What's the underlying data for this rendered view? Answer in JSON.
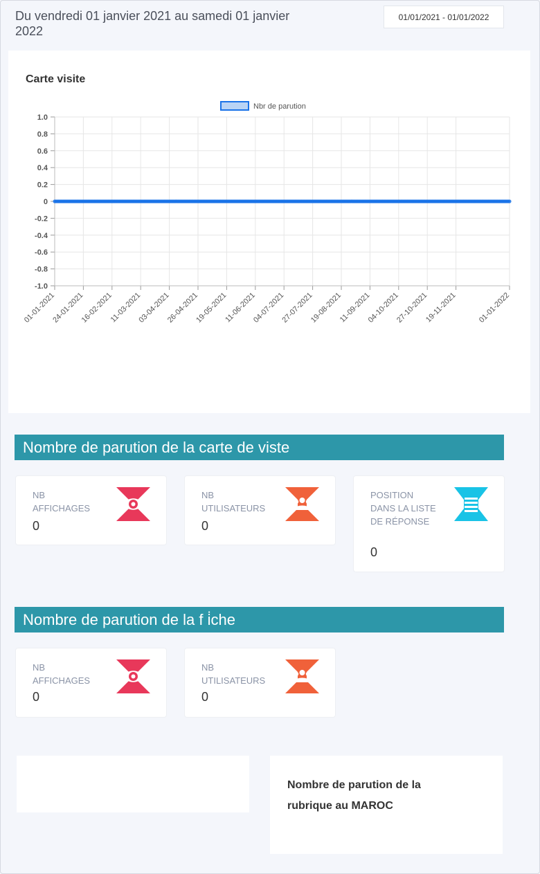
{
  "header": {
    "date_range_text": "Du vendredi 01 janvier 2021 au samedi 01 janvier 2022",
    "date_input_value": "01/01/2021 - 01/01/2022"
  },
  "chart_card": {
    "title": "Carte visite"
  },
  "chart_data": {
    "type": "line",
    "title": "Carte visite",
    "legend": "Nbr de parution",
    "legend_position": "top-center",
    "series": [
      {
        "name": "Nbr de parution",
        "color": "#1a73e8"
      }
    ],
    "x_ticks": [
      "01-01-2021",
      "24-01-2021",
      "16-02-2021",
      "11-03-2021",
      "03-04-2021",
      "26-04-2021",
      "19-05-2021",
      "11-06-2021",
      "04-07-2021",
      "27-07-2021",
      "19-08-2021",
      "11-09-2021",
      "04-10-2021",
      "27-10-2021",
      "19-11-2021",
      "01-01-2022"
    ],
    "x_start": "01-01-2021",
    "x_end": "01-01-2022",
    "y_value_all": 0,
    "y_ticks": [
      "1.0",
      "0.8",
      "0.6",
      "0.4",
      "0.2",
      "0",
      "-0.2",
      "-0.4",
      "-0.6",
      "-0.8",
      "-1.0"
    ],
    "ylim": [
      -1.0,
      1.0
    ],
    "grid": true
  },
  "section_carte": {
    "title": "Nombre de parution de la carte de viste",
    "cards": [
      {
        "label": "NB AFFICHAGES",
        "value": "0",
        "icon": "eye-icon",
        "color": "#e8385a"
      },
      {
        "label": "NB UTILISATEURS",
        "value": "0",
        "icon": "users-icon",
        "color": "#f0613a"
      },
      {
        "label": "POSITION DANS LA LISTE DE RÉPONSE",
        "value": "0",
        "icon": "list-icon",
        "color": "#19c3e6"
      }
    ]
  },
  "section_fiche": {
    "title": "Nombre de parution de la f i̇che",
    "cards": [
      {
        "label": "NB AFFICHAGES",
        "value": "0",
        "icon": "eye-icon",
        "color": "#e8385a"
      },
      {
        "label": "NB UTILISATEURS",
        "value": "0",
        "icon": "users-icon",
        "color": "#f0613a"
      }
    ]
  },
  "rubrique": {
    "title": "Nombre de parution de la rubrique au MAROC"
  }
}
